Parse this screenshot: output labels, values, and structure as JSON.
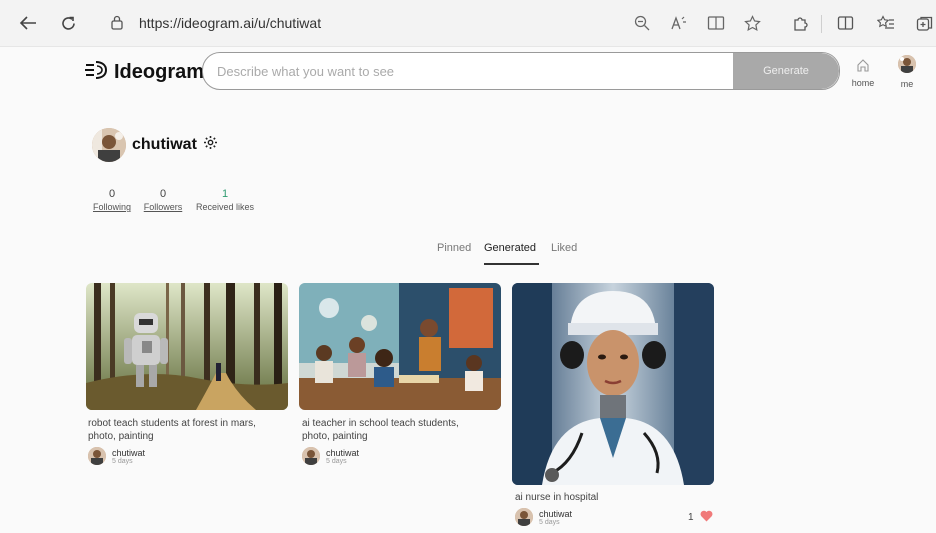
{
  "browser": {
    "url": "https://ideogram.ai/u/chutiwat",
    "icons": [
      "back-arrow-icon",
      "reload-icon",
      "lock-icon",
      "zoom-out-icon",
      "read-aloud-icon",
      "immersive-reader-icon",
      "favorite-star-icon",
      "extensions-icon",
      "split-screen-icon",
      "favorites-list-icon",
      "collections-icon"
    ]
  },
  "header": {
    "logo_text": "Ideogram",
    "search_placeholder": "Describe what you want to see",
    "generate_label": "Generate",
    "home_label": "home",
    "me_label": "me"
  },
  "profile": {
    "username": "chutiwat",
    "stats": [
      {
        "value": "0",
        "label": "Following"
      },
      {
        "value": "0",
        "label": "Followers"
      },
      {
        "value": "1",
        "label": "Received likes"
      }
    ]
  },
  "tabs": [
    {
      "label": "Pinned",
      "active": false
    },
    {
      "label": "Generated",
      "active": true
    },
    {
      "label": "Liked",
      "active": false
    }
  ],
  "cards": [
    {
      "title_line1": "robot teach students at forest in mars,",
      "title_line2": "photo, painting",
      "user": "chutiwat",
      "time": "5 days"
    },
    {
      "title_line1": "ai teacher in school teach students,",
      "title_line2": "photo, painting",
      "user": "chutiwat",
      "time": "5 days"
    },
    {
      "title_line1": "ai nurse in hospital",
      "title_line2": "",
      "user": "chutiwat",
      "time": "5 days",
      "likes": "1"
    }
  ],
  "colors": {
    "like_heart": "#f07a7a",
    "generate_btn": "#a9a9a9",
    "page_bg": "#fafafa"
  }
}
